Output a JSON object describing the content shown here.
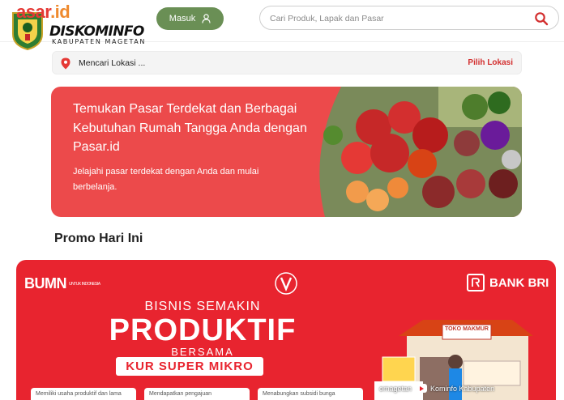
{
  "header": {
    "brand": "pasar.id",
    "brand_main": "asar",
    "brand_ext": ".id",
    "diskominfo": "DISKOMINFO",
    "kabupaten": "KABUPATEN MAGETAN",
    "login_label": "Masuk",
    "search_placeholder": "Cari Produk, Lapak dan Pasar",
    "icons": [
      "user-icon",
      "search-icon",
      "emblem-icon"
    ]
  },
  "location": {
    "text": "Mencari Lokasi ...",
    "action": "Pilih Lokasi"
  },
  "hero": {
    "title": "Temukan Pasar Terdekat dan Berbagai Kebutuhan Rumah Tangga Anda dengan Pasar.id",
    "subtitle": "Jelajahi pasar terdekat dengan Anda dan mulai berbelanja."
  },
  "promo": {
    "section_title": "Promo Hari Ini",
    "bumn": "BUMN",
    "bumn_tag": "UNTUK INDONESIA",
    "bank": "BANK BRI",
    "line1": "BISNIS SEMAKIN",
    "line2": "PRODUKTIF",
    "line3": "BERSAMA",
    "kur": "KUR SUPER MIKRO",
    "store_sign": "TOKO MAKMUR",
    "cards": [
      "Memiliki usaha produktif dan lama",
      "Mendapatkan pengajuan",
      "Menabungkan subsidi bunga"
    ]
  },
  "watermark": "Kominfo Kabupaten",
  "watermark_prefix": "omagetan",
  "colors": {
    "accent": "#ec4a4b",
    "login_button": "#6a8f55",
    "banner": "#e8242f",
    "link": "#d32f2f"
  }
}
